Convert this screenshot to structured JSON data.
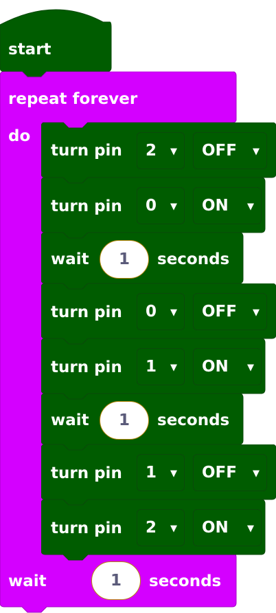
{
  "colors": {
    "green": "#005c00",
    "magenta": "#d400ff",
    "white": "#ffffff",
    "pill_text": "#5b5b7a"
  },
  "blocks": {
    "start": {
      "label": "start"
    },
    "repeat": {
      "label": "repeat forever",
      "do": "do"
    },
    "inner": [
      {
        "type": "turn",
        "label": "turn pin",
        "pin": "2",
        "state": "OFF"
      },
      {
        "type": "turn",
        "label": "turn pin",
        "pin": "0",
        "state": "ON"
      },
      {
        "type": "wait",
        "label": "wait",
        "value": "1",
        "unit": "seconds"
      },
      {
        "type": "turn",
        "label": "turn pin",
        "pin": "0",
        "state": "OFF"
      },
      {
        "type": "turn",
        "label": "turn pin",
        "pin": "1",
        "state": "ON"
      },
      {
        "type": "wait",
        "label": "wait",
        "value": "1",
        "unit": "seconds"
      },
      {
        "type": "turn",
        "label": "turn pin",
        "pin": "1",
        "state": "OFF"
      },
      {
        "type": "turn",
        "label": "turn pin",
        "pin": "2",
        "state": "ON"
      }
    ],
    "bottom_wait": {
      "label": "wait",
      "value": "1",
      "unit": "seconds"
    }
  },
  "icons": {
    "dropdown": "caret-down-icon"
  }
}
